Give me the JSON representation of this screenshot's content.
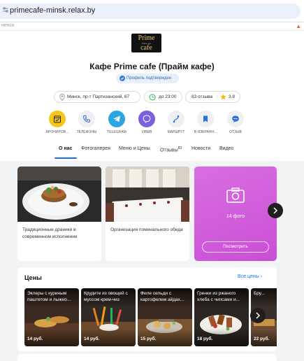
{
  "browser": {
    "url": "primecafe-minsk.relax.by",
    "strip_text": "ненск"
  },
  "logo": {
    "line1": "Prime",
    "line2": "Prime cafe",
    "line3": "cafe"
  },
  "title": "Кафе Prime cafe (Прайм кафе)",
  "verified": "Профиль подтвержден",
  "chips": {
    "address": "Минск, пр-т Партизанский, 67",
    "hours": "до 23:00",
    "reviews": "83 отзыва",
    "rating": "3.8"
  },
  "actions": [
    {
      "label": "БРОНИРОВ...",
      "color": "#f6c619"
    },
    {
      "label": "ТЕЛЕФОНЫ",
      "color": "#eef0f3"
    },
    {
      "label": "TELEGRAM",
      "color": "#2ca5e0"
    },
    {
      "label": "VIBER",
      "color": "#7a5fe0"
    },
    {
      "label": "МАРШРУТ",
      "color": "#eef0f3"
    },
    {
      "label": "В ИЗБРАНН...",
      "color": "#eef0f3"
    },
    {
      "label": "ОТЗЫВ",
      "color": "#eef0f3"
    }
  ],
  "tabs": [
    {
      "label": "О нас"
    },
    {
      "label": "Фотогалерея"
    },
    {
      "label": "Меню и Цены"
    },
    {
      "label": "Отзывы",
      "count": "83"
    },
    {
      "label": "Новости"
    },
    {
      "label": "Видео"
    }
  ],
  "cards": [
    {
      "caption": "Традиционные драники в современном исполнении"
    },
    {
      "caption": "Организация поминального обеда"
    }
  ],
  "photos": {
    "count": "14 фото",
    "button": "Посмотреть"
  },
  "prices": {
    "title": "Цены",
    "all": "Все цены",
    "items": [
      {
        "name": "Эклеры с куриным паштетом и лыжно...",
        "price": "14 руб."
      },
      {
        "name": "Крудите из овощей с муссом крем-чиз",
        "price": "14 руб."
      },
      {
        "name": "Филе сельди с картофелем айдах...",
        "price": "15 руб."
      },
      {
        "name": "Гренки из ржаного хлеба с чипсами и...",
        "price": "18 руб."
      },
      {
        "name": "Бру...",
        "price": "22 руб."
      }
    ]
  },
  "colors": {
    "accent": "#1a73e8",
    "photo_tile": "#d05ad9"
  }
}
